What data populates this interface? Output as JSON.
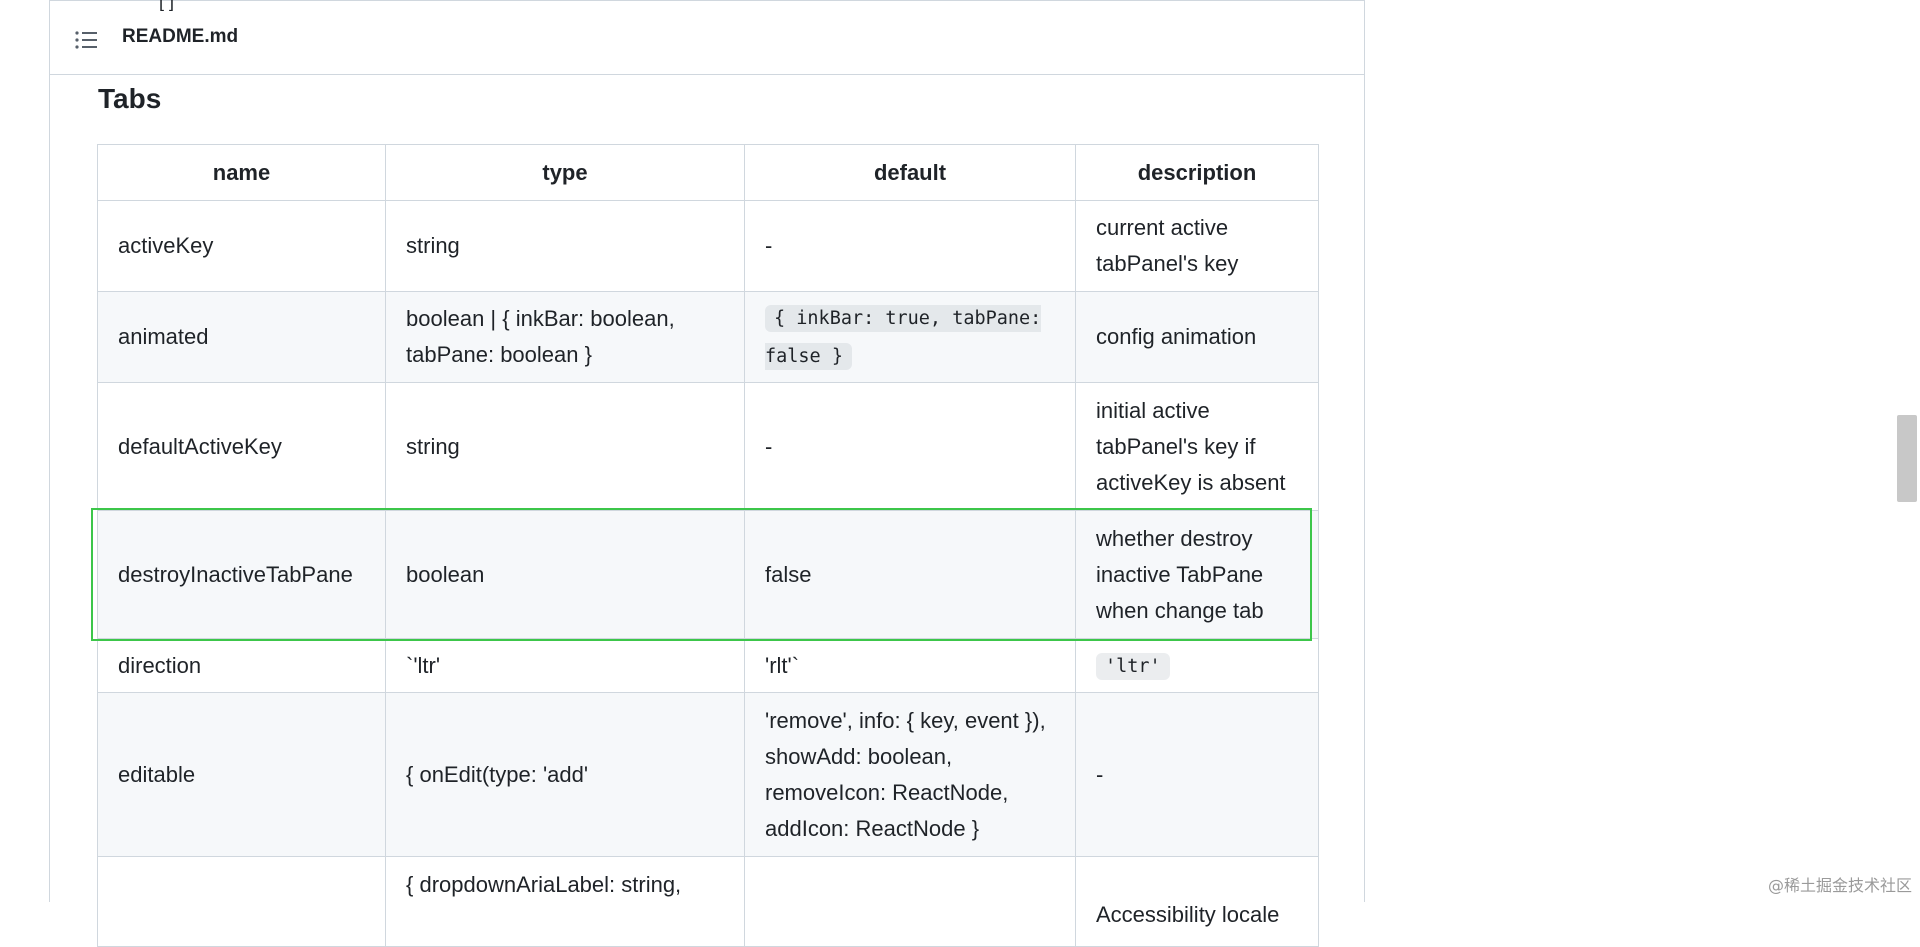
{
  "readme": {
    "filename": "README.md",
    "top_stub": "[ ]",
    "section_title": "Tabs"
  },
  "table": {
    "headers": [
      "name",
      "type",
      "default",
      "description"
    ],
    "rows": [
      {
        "name": "activeKey",
        "type": "string",
        "default": "-",
        "description": "current active tabPanel's key"
      },
      {
        "name": "animated",
        "type": "boolean | { inkBar: boolean, tabPane: boolean }",
        "default_code": "{ inkBar: true, tabPane: false }",
        "description": "config animation"
      },
      {
        "name": "defaultActiveKey",
        "type": "string",
        "default": "-",
        "description": "initial active tabPanel's key if activeKey is absent"
      },
      {
        "name": "destroyInactiveTabPane",
        "type": "boolean",
        "default": "false",
        "description": "whether destroy inactive TabPane when change tab"
      },
      {
        "name": "direction",
        "type": "`'ltr'",
        "default": "'rlt'`",
        "description_code": "'ltr'"
      },
      {
        "name": "editable",
        "type": "{ onEdit(type: 'add'",
        "default": "'remove', info: { key, event }), showAdd: boolean, removeIcon: ReactNode, addIcon: ReactNode }",
        "description": "-"
      },
      {
        "name": "",
        "type": "{ dropdownAriaLabel: string,",
        "default": "",
        "description": "Accessibility locale"
      }
    ]
  },
  "highlight": {
    "row": "destroyInactiveTabPane",
    "color": "#3cc64a"
  },
  "watermark": "@稀土掘金技术社区",
  "icons": {
    "toc": "list-icon"
  }
}
